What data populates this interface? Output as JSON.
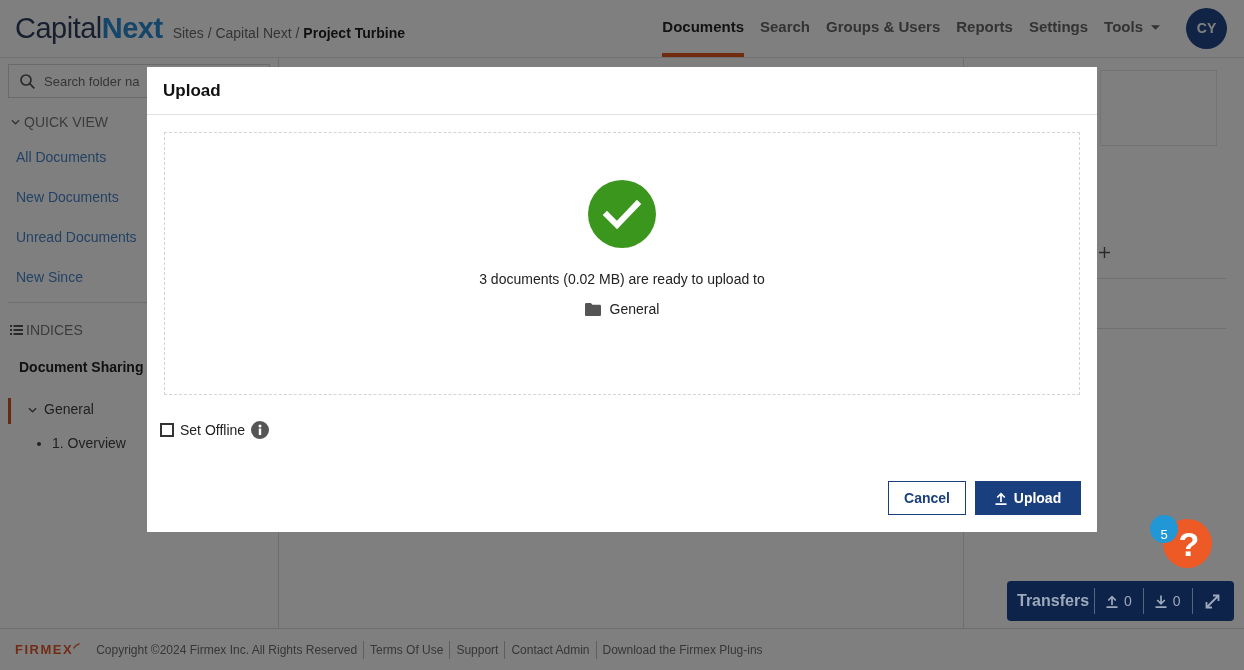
{
  "header": {
    "logo": {
      "part_1": "Capital",
      "part_2": "Next"
    },
    "breadcrumb": "Sites / Capital Next / **Project Turbine**",
    "nav": [
      {
        "label": "Documents",
        "kind": "link",
        "selected": true
      },
      {
        "label": "Search",
        "kind": "link",
        "selected": false
      },
      {
        "label": "Groups & Users",
        "kind": "link",
        "selected": false
      },
      {
        "label": "Reports",
        "kind": "link",
        "selected": false
      },
      {
        "label": "Settings",
        "kind": "link",
        "selected": false
      },
      {
        "label": "Tools",
        "kind": "dropdown",
        "selected": false
      }
    ],
    "avatar": "CY"
  },
  "sidebar": {
    "search": {
      "placeholder": "Search folder na"
    },
    "quick_view": {
      "title": "QUICK VIEW",
      "expanded": true,
      "items": [
        "All Documents",
        "New Documents",
        "Unread Documents",
        "New Since"
      ]
    },
    "indices": {
      "title": "INDICES",
      "root": "Document Sharing",
      "tree": [
        {
          "label": "General",
          "expanded": true,
          "selected": true,
          "children": [
            {
              "label": "1. Overview",
              "selected": false
            }
          ]
        }
      ]
    }
  },
  "dialog": {
    "title": "Upload",
    "message": "3 documents (0.02 MB) are ready to upload to",
    "folder": "General",
    "set_offline": {
      "label": "Set Offline",
      "checked": false
    },
    "buttons": [
      {
        "label": "Cancel",
        "kind": "secondary"
      },
      {
        "label": "Upload",
        "kind": "primary"
      }
    ]
  },
  "help": {
    "label": "?",
    "badge": "5"
  },
  "transfers": {
    "title": "Transfers",
    "uploads": "0",
    "downloads": "0"
  },
  "footer": {
    "brand": "FIRMEX",
    "copyright": "Copyright ©2024 Firmex Inc. All Rights Reserved",
    "links": [
      "Terms Of Use",
      "Support",
      "Contact Admin",
      "Download the Firmex Plug-ins"
    ]
  }
}
